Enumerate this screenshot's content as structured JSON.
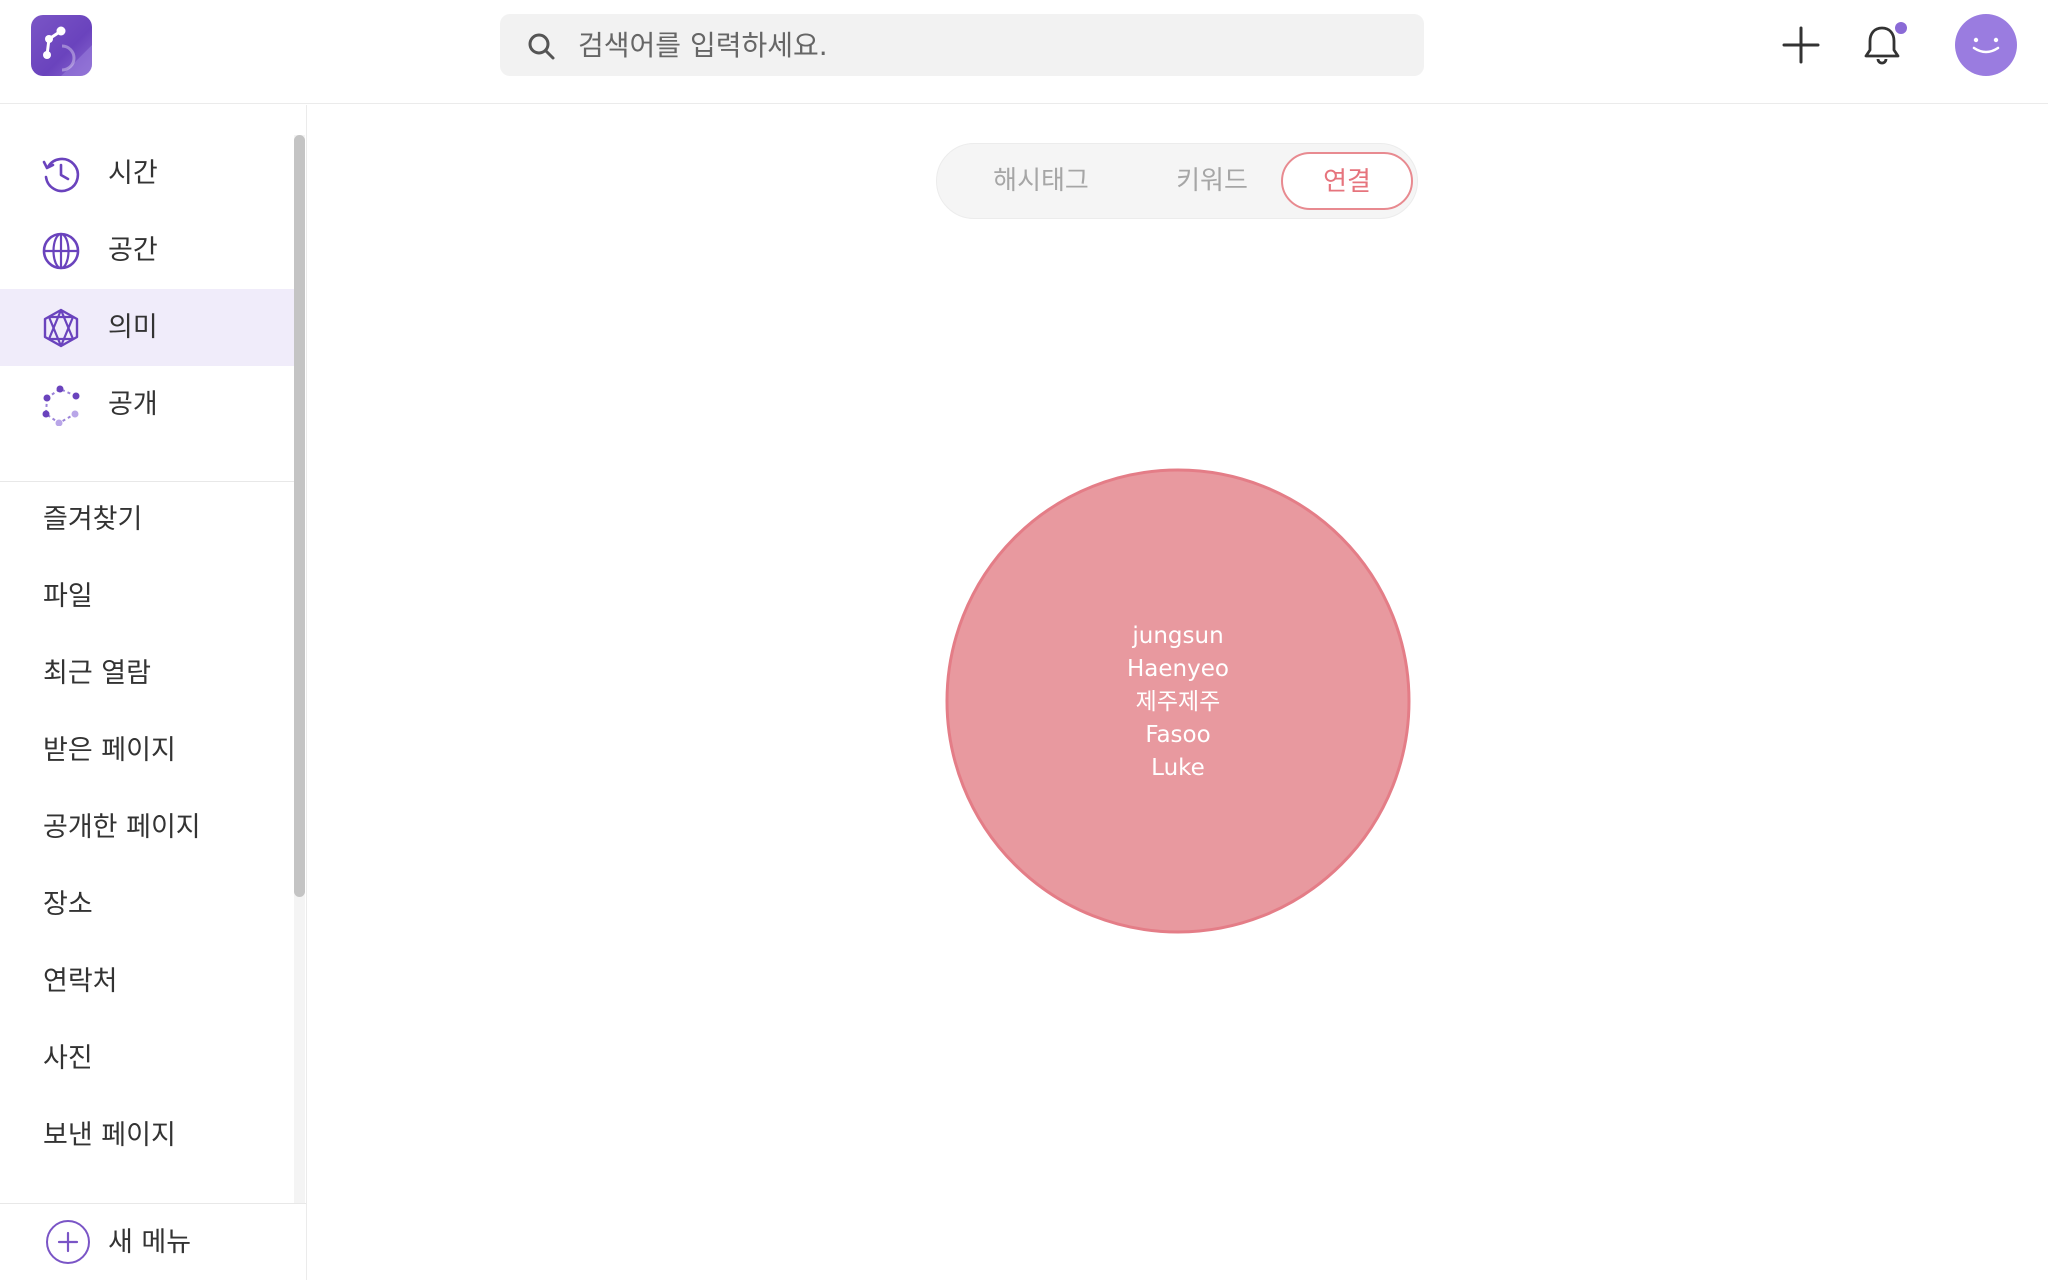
{
  "header": {
    "logo_icon": "app-logo-network",
    "search": {
      "placeholder": "검색어를 입력하세요.",
      "value": "",
      "icon": "search-icon"
    },
    "actions": {
      "add_icon": "plus-icon",
      "notification_icon": "bell-icon",
      "has_notification": true,
      "avatar_icon": "smiley-avatar"
    }
  },
  "sidebar": {
    "primary": [
      {
        "label": "시간",
        "icon": "history-clock-icon",
        "active": false
      },
      {
        "label": "공간",
        "icon": "globe-icon",
        "active": false
      },
      {
        "label": "의미",
        "icon": "meaning-star-icon",
        "active": true
      },
      {
        "label": "공개",
        "icon": "share-network-icon",
        "active": false
      }
    ],
    "menu": [
      {
        "label": "즐겨찾기"
      },
      {
        "label": "파일"
      },
      {
        "label": "최근 열람"
      },
      {
        "label": "받은 페이지"
      },
      {
        "label": "공개한 페이지"
      },
      {
        "label": "장소"
      },
      {
        "label": "연락처"
      },
      {
        "label": "사진"
      },
      {
        "label": "보낸 페이지"
      }
    ],
    "new_menu": {
      "label": "새 메뉴",
      "icon": "plus-circle-icon"
    }
  },
  "main": {
    "tabs": [
      {
        "label": "해시태그",
        "active": false
      },
      {
        "label": "키워드",
        "active": false
      },
      {
        "label": "연결",
        "active": true
      }
    ],
    "graph": {
      "bubble_color": "#e8999f",
      "bubble_stroke": "#e47d87",
      "nodes": [
        "jungsun",
        "Haenyeo",
        "제주제주",
        "Fasoo",
        "Luke"
      ]
    }
  },
  "colors": {
    "brand": "#6a43bd",
    "accent_purple": "#8a6ad6",
    "active_tab": "#e6747d",
    "sidebar_active_bg": "#f0ecfa"
  }
}
